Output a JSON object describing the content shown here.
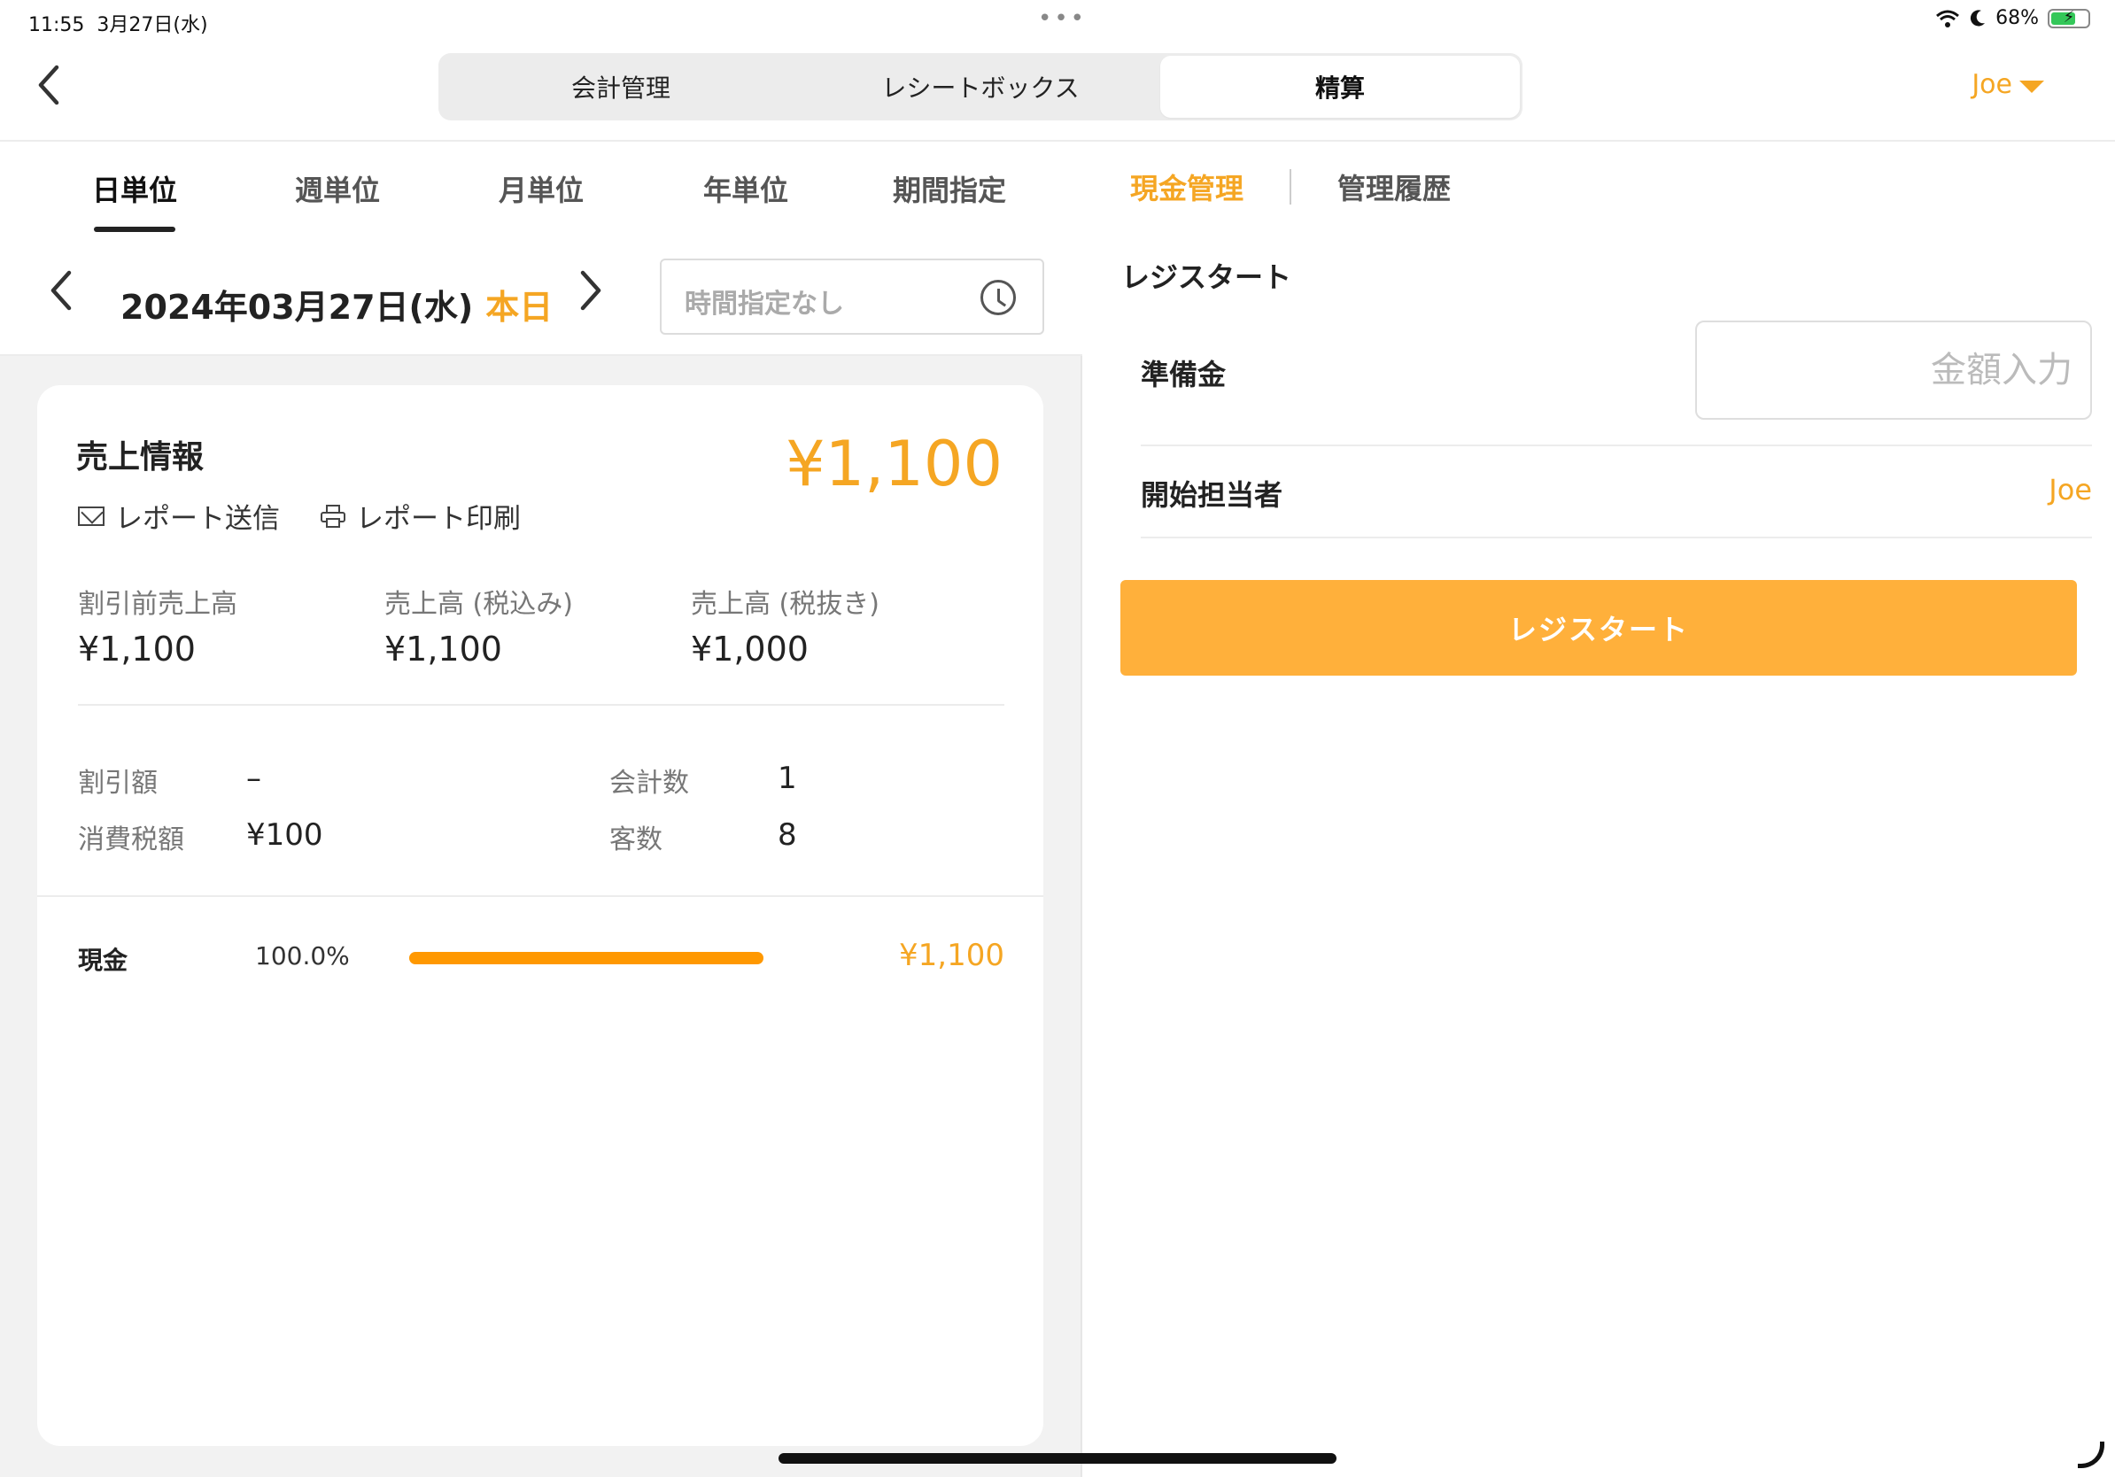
{
  "status_bar": {
    "time": "11:55",
    "date": "3月27日(水)",
    "battery": "68%"
  },
  "nav": {
    "tabs": [
      {
        "label": "会計管理",
        "active": false
      },
      {
        "label": "レシートボックス",
        "active": false
      },
      {
        "label": "精算",
        "active": true
      }
    ],
    "user": "Joe"
  },
  "period_tabs": [
    {
      "label": "日単位",
      "active": true
    },
    {
      "label": "週単位",
      "active": false
    },
    {
      "label": "月単位",
      "active": false
    },
    {
      "label": "年単位",
      "active": false
    },
    {
      "label": "期間指定",
      "active": false
    }
  ],
  "date_selector": {
    "date": "2024年03月27日(水)",
    "today": "本日",
    "time_placeholder": "時間指定なし"
  },
  "sales": {
    "title": "売上情報",
    "total": "¥1,100",
    "actions": {
      "send": "レポート送信",
      "print": "レポート印刷"
    },
    "metrics": [
      {
        "label": "割引前売上高",
        "value": "¥1,100"
      },
      {
        "label": "売上高 (税込み)",
        "value": "¥1,100"
      },
      {
        "label": "売上高 (税抜き)",
        "value": "¥1,000"
      }
    ],
    "details": {
      "discount_label": "割引額",
      "discount_value": "–",
      "tax_label": "消費税額",
      "tax_value": "¥100",
      "checkout_label": "会計数",
      "checkout_value": "1",
      "customers_label": "客数",
      "customers_value": "8"
    },
    "payments": [
      {
        "name": "現金",
        "percent_label": "100.0%",
        "percent": 100,
        "amount": "¥1,100"
      }
    ]
  },
  "right_panel": {
    "tabs": [
      {
        "label": "現金管理",
        "active": true
      },
      {
        "label": "管理履歴",
        "active": false
      }
    ],
    "section_title": "レジスタート",
    "reserve_label": "準備金",
    "reserve_placeholder": "金額入力",
    "reserve_value": "",
    "starter_label": "開始担当者",
    "starter_value": "Joe",
    "start_button": "レジスタート"
  },
  "colors": {
    "accent": "#f5a623",
    "button": "#ffb03b",
    "bar": "#ff9800"
  }
}
